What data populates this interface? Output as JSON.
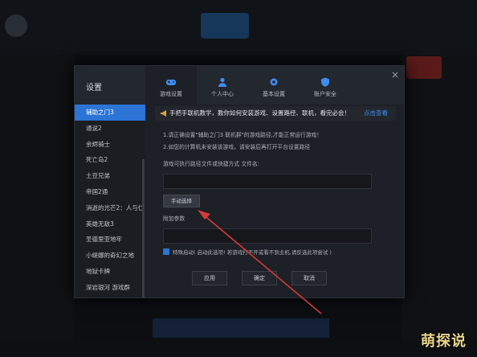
{
  "dialog": {
    "title": "设置",
    "tabs": [
      {
        "label": "游戏设置",
        "icon": "gamepad-icon"
      },
      {
        "label": "个人中心",
        "icon": "user-icon"
      },
      {
        "label": "基本设置",
        "icon": "gear-icon"
      },
      {
        "label": "账户安全",
        "icon": "shield-icon"
      }
    ],
    "close": "×"
  },
  "sidebar": {
    "items": [
      "辅助之门3",
      "通说2",
      "余烬骑士",
      "死亡岛2",
      "土豆兄弟",
      "帝国2通",
      "消逝的光芒2：人与仁",
      "英雄无敌3",
      "圣德里亚地牢",
      "小缇娜的奇幻之地",
      "地狱卡牌",
      "深岩银河 游戏群"
    ]
  },
  "notice": {
    "text": "手把手联机教学，教你如何安装游戏、设置路径、联机，看完必会！",
    "link": "点击查看"
  },
  "tips": [
    "1.请正确设置\"辅助之门3 联机群\"的游戏路径,才能正常运行游戏！",
    "2.如您的计算机未安装该游戏，请安装后再打开平台设置路径"
  ],
  "path_label": "游戏可执行路径文件或快捷方式 文件名:",
  "browse_button": "手动选择",
  "params_label": "附加参数",
  "checkbox_text": "特殊启动( 启动此选项! 若游戏打不开或看不到主机,请反选此项尝试 )",
  "buttons": {
    "apply": "应用",
    "ok": "确定",
    "cancel": "取消"
  },
  "watermark": "萌探说",
  "colors": {
    "accent": "#2c74d6",
    "arrow": "#d23a3a",
    "link": "#3f8cf2"
  }
}
